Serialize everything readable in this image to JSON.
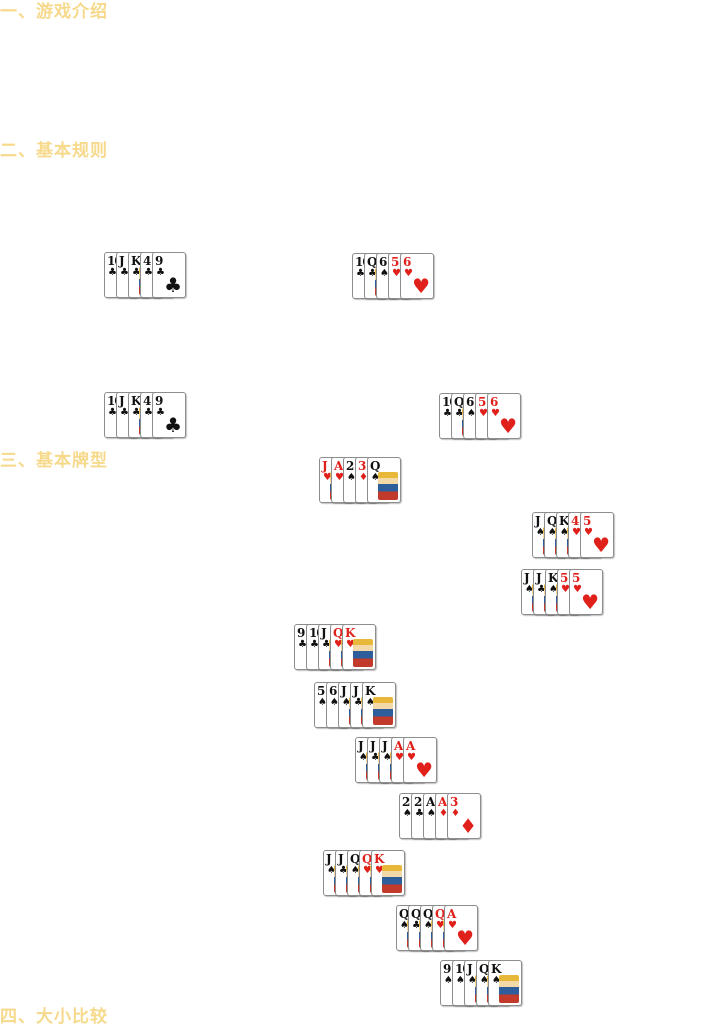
{
  "sections": [
    {
      "title": "一、游戏介绍"
    },
    {
      "title": "二、基本规则"
    },
    {
      "title": "三、基本牌型"
    },
    {
      "title": "四、大小比较"
    }
  ],
  "colors": {
    "title": "#f6d98a",
    "red_suit": "#e0201b",
    "black_suit": "#111111"
  },
  "hands": [
    {
      "cards": [
        {
          "rank": "10",
          "suit": "♣"
        },
        {
          "rank": "J",
          "suit": "♣"
        },
        {
          "rank": "K",
          "suit": "♣",
          "face": true
        },
        {
          "rank": "4",
          "suit": "♣"
        },
        {
          "rank": "9",
          "suit": "♣"
        }
      ]
    },
    {
      "cards": [
        {
          "rank": "10",
          "suit": "♣"
        },
        {
          "rank": "Q",
          "suit": "♣",
          "face": true
        },
        {
          "rank": "6",
          "suit": "♠"
        },
        {
          "rank": "5",
          "suit": "♥"
        },
        {
          "rank": "6",
          "suit": "♥"
        }
      ]
    },
    {
      "cards": [
        {
          "rank": "10",
          "suit": "♣"
        },
        {
          "rank": "J",
          "suit": "♣"
        },
        {
          "rank": "K",
          "suit": "♣",
          "face": true
        },
        {
          "rank": "4",
          "suit": "♣"
        },
        {
          "rank": "9",
          "suit": "♣"
        }
      ]
    },
    {
      "cards": [
        {
          "rank": "10",
          "suit": "♣"
        },
        {
          "rank": "Q",
          "suit": "♣",
          "face": true
        },
        {
          "rank": "6",
          "suit": "♠"
        },
        {
          "rank": "5",
          "suit": "♥"
        },
        {
          "rank": "6",
          "suit": "♥"
        }
      ]
    },
    {
      "cards": [
        {
          "rank": "J",
          "suit": "♥",
          "face": true
        },
        {
          "rank": "A",
          "suit": "♥"
        },
        {
          "rank": "2",
          "suit": "♠"
        },
        {
          "rank": "3",
          "suit": "♦"
        },
        {
          "rank": "Q",
          "suit": "♠",
          "face": true
        }
      ]
    },
    {
      "cards": [
        {
          "rank": "J",
          "suit": "♠",
          "face": true
        },
        {
          "rank": "Q",
          "suit": "♠",
          "face": true
        },
        {
          "rank": "K",
          "suit": "♠",
          "face": true
        },
        {
          "rank": "4",
          "suit": "♥"
        },
        {
          "rank": "5",
          "suit": "♥"
        }
      ]
    },
    {
      "cards": [
        {
          "rank": "J",
          "suit": "♠",
          "face": true
        },
        {
          "rank": "J",
          "suit": "♣",
          "face": true
        },
        {
          "rank": "K",
          "suit": "♠",
          "face": true
        },
        {
          "rank": "5",
          "suit": "♥"
        },
        {
          "rank": "5",
          "suit": "♥"
        }
      ]
    },
    {
      "cards": [
        {
          "rank": "9",
          "suit": "♣"
        },
        {
          "rank": "10",
          "suit": "♣"
        },
        {
          "rank": "J",
          "suit": "♣",
          "face": true
        },
        {
          "rank": "Q",
          "suit": "♥",
          "face": true
        },
        {
          "rank": "K",
          "suit": "♥",
          "face": true
        }
      ]
    },
    {
      "cards": [
        {
          "rank": "5",
          "suit": "♠"
        },
        {
          "rank": "6",
          "suit": "♠"
        },
        {
          "rank": "J",
          "suit": "♠",
          "face": true
        },
        {
          "rank": "J",
          "suit": "♣",
          "face": true
        },
        {
          "rank": "K",
          "suit": "♠",
          "face": true
        }
      ]
    },
    {
      "cards": [
        {
          "rank": "J",
          "suit": "♠",
          "face": true
        },
        {
          "rank": "J",
          "suit": "♣",
          "face": true
        },
        {
          "rank": "J",
          "suit": "♠",
          "face": true
        },
        {
          "rank": "A",
          "suit": "♥"
        },
        {
          "rank": "A",
          "suit": "♥"
        }
      ]
    },
    {
      "cards": [
        {
          "rank": "2",
          "suit": "♠"
        },
        {
          "rank": "2",
          "suit": "♣"
        },
        {
          "rank": "A",
          "suit": "♠"
        },
        {
          "rank": "A",
          "suit": "♦"
        },
        {
          "rank": "3",
          "suit": "♦"
        }
      ]
    },
    {
      "cards": [
        {
          "rank": "J",
          "suit": "♠",
          "face": true
        },
        {
          "rank": "J",
          "suit": "♣",
          "face": true
        },
        {
          "rank": "Q",
          "suit": "♠",
          "face": true
        },
        {
          "rank": "Q",
          "suit": "♥",
          "face": true
        },
        {
          "rank": "K",
          "suit": "♥",
          "face": true
        }
      ]
    },
    {
      "cards": [
        {
          "rank": "Q",
          "suit": "♠",
          "face": true
        },
        {
          "rank": "Q",
          "suit": "♣",
          "face": true
        },
        {
          "rank": "Q",
          "suit": "♠",
          "face": true
        },
        {
          "rank": "Q",
          "suit": "♥",
          "face": true
        },
        {
          "rank": "A",
          "suit": "♥"
        }
      ]
    },
    {
      "cards": [
        {
          "rank": "9",
          "suit": "♠"
        },
        {
          "rank": "10",
          "suit": "♠"
        },
        {
          "rank": "J",
          "suit": "♠",
          "face": true
        },
        {
          "rank": "Q",
          "suit": "♠",
          "face": true
        },
        {
          "rank": "K",
          "suit": "♠",
          "face": true
        }
      ]
    }
  ]
}
